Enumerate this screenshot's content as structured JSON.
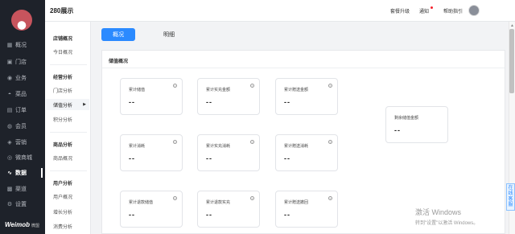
{
  "sidebar": {
    "items": [
      {
        "label": "概况",
        "icon": "grid-icon"
      },
      {
        "label": "门店",
        "icon": "store-icon"
      },
      {
        "label": "业务",
        "icon": "business-icon"
      },
      {
        "label": "菜品",
        "icon": "dish-icon"
      },
      {
        "label": "订单",
        "icon": "order-icon"
      },
      {
        "label": "会员",
        "icon": "member-icon"
      },
      {
        "label": "营销",
        "icon": "marketing-icon"
      },
      {
        "label": "微商城",
        "icon": "mall-icon"
      },
      {
        "label": "数据",
        "icon": "data-icon"
      },
      {
        "label": "渠道",
        "icon": "channel-icon"
      },
      {
        "label": "设置",
        "icon": "settings-icon"
      }
    ],
    "active": "数据",
    "brand": "Weimob",
    "brand_sub": "微盟"
  },
  "header": {
    "shop_name": "280展示",
    "links": {
      "upgrade": "套餐升级",
      "notice": "通知",
      "help": "帮助指引"
    }
  },
  "submenu": {
    "groups": [
      {
        "title": "店铺概况",
        "items": [
          "今日概况"
        ]
      },
      {
        "title": "经营分析",
        "items": [
          "门店分析",
          "储值分析",
          "积分分析"
        ]
      },
      {
        "title": "商品分析",
        "items": [
          "商品概况"
        ]
      },
      {
        "title": "用户分析",
        "items": [
          "用户概况",
          "增长分析",
          "消费分析"
        ]
      }
    ],
    "active_item": "储值分析"
  },
  "tabs": {
    "overview": "概况",
    "detail": "明细",
    "active": "概况"
  },
  "panel": {
    "title": "储值概况",
    "cards": [
      {
        "label": "累计储值",
        "value": "--"
      },
      {
        "label": "累计实充金额",
        "value": "--"
      },
      {
        "label": "累计赠送金额",
        "value": "--"
      },
      {
        "label": "累计消耗",
        "value": "--"
      },
      {
        "label": "累计实充消耗",
        "value": "--"
      },
      {
        "label": "累计赠送消耗",
        "value": "--"
      },
      {
        "label": "累计退款储值",
        "value": "--"
      },
      {
        "label": "累计退款实充",
        "value": "--"
      },
      {
        "label": "累计赠送撤回",
        "value": "--"
      },
      {
        "label": "剩余储值金额",
        "value": "--"
      }
    ]
  },
  "help_icon_glyph": "?",
  "online_service": "在线客服",
  "watermark": {
    "title": "激活 Windows",
    "subtitle": "转到\"设置\"以激活 Windows。"
  },
  "colors": {
    "sidebar_bg": "#1e222a",
    "accent": "#2b8aff",
    "page_bg": "#f2f3f5",
    "notice_dot": "#f5222d"
  }
}
